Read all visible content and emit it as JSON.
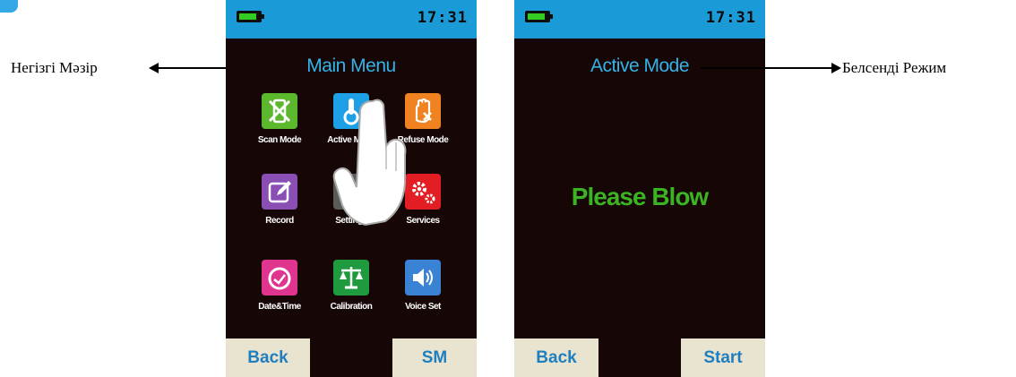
{
  "screen1": {
    "time": "17:31",
    "title": "Main Menu",
    "tiles": [
      {
        "label": "Scan Mode",
        "icon": "scan-mode-icon",
        "color": "#5bb82c"
      },
      {
        "label": "Active Mode",
        "icon": "active-mode-icon",
        "color": "#1ea0e6"
      },
      {
        "label": "Refuse Mode",
        "icon": "refuse-mode-icon",
        "color": "#f08222"
      },
      {
        "label": "Record",
        "icon": "record-icon",
        "color": "#8a4fb4"
      },
      {
        "label": "Settings",
        "icon": "settings-icon",
        "color": "#5a5a5a"
      },
      {
        "label": "Services",
        "icon": "services-icon",
        "color": "#e21d24"
      },
      {
        "label": "Date&Time",
        "icon": "clock-icon",
        "color": "#e0358f"
      },
      {
        "label": "Calibration",
        "icon": "scale-icon",
        "color": "#1f9a3e"
      },
      {
        "label": "Voice Set",
        "icon": "speaker-icon",
        "color": "#3a82d4"
      }
    ],
    "back_label": "Back",
    "right_label": "SM"
  },
  "screen2": {
    "time": "17:31",
    "title": "Active Mode",
    "message": "Please Blow",
    "back_label": "Back",
    "start_label": "Start"
  },
  "callouts": {
    "left": "Негізгі Мәзір",
    "right": "Белсенді Режим"
  }
}
